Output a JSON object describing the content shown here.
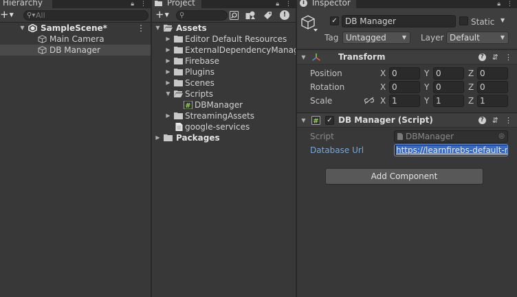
{
  "hierarchy": {
    "tab_title": "Hierarchy",
    "search_placeholder": "All",
    "items": [
      {
        "label": "SampleScene*"
      },
      {
        "label": "Main Camera"
      },
      {
        "label": "DB Manager"
      }
    ]
  },
  "project": {
    "tab_title": "Project",
    "search_placeholder": "",
    "items": [
      {
        "label": "Assets"
      },
      {
        "label": "Editor Default Resources"
      },
      {
        "label": "ExternalDependencyManager"
      },
      {
        "label": "Firebase"
      },
      {
        "label": "Plugins"
      },
      {
        "label": "Scenes"
      },
      {
        "label": "Scripts"
      },
      {
        "label": "DBManager"
      },
      {
        "label": "StreamingAssets"
      },
      {
        "label": "google-services"
      },
      {
        "label": "Packages"
      }
    ]
  },
  "inspector": {
    "tab_title": "Inspector",
    "object_name": "DB Manager",
    "static_label": "Static",
    "tag_label": "Tag",
    "tag_value": "Untagged",
    "layer_label": "Layer",
    "layer_value": "Default",
    "transform": {
      "title": "Transform",
      "position": {
        "label": "Position",
        "x": "0",
        "y": "0",
        "z": "0"
      },
      "rotation": {
        "label": "Rotation",
        "x": "0",
        "y": "0",
        "z": "0"
      },
      "scale": {
        "label": "Scale",
        "x": "1",
        "y": "1",
        "z": "1"
      },
      "axis_x": "X",
      "axis_y": "Y",
      "axis_z": "Z"
    },
    "script_component": {
      "title": "DB Manager (Script)",
      "script_label": "Script",
      "script_value": "DBManager",
      "url_label": "Database Url",
      "url_value": "https://learnfirebs-default-rt"
    },
    "add_component_label": "Add Component"
  },
  "colors": {
    "panel_bg": "#383838",
    "selection": "#4a4a4a",
    "url_label": "#7ba7d7",
    "url_highlight": "#3a6ac2"
  }
}
